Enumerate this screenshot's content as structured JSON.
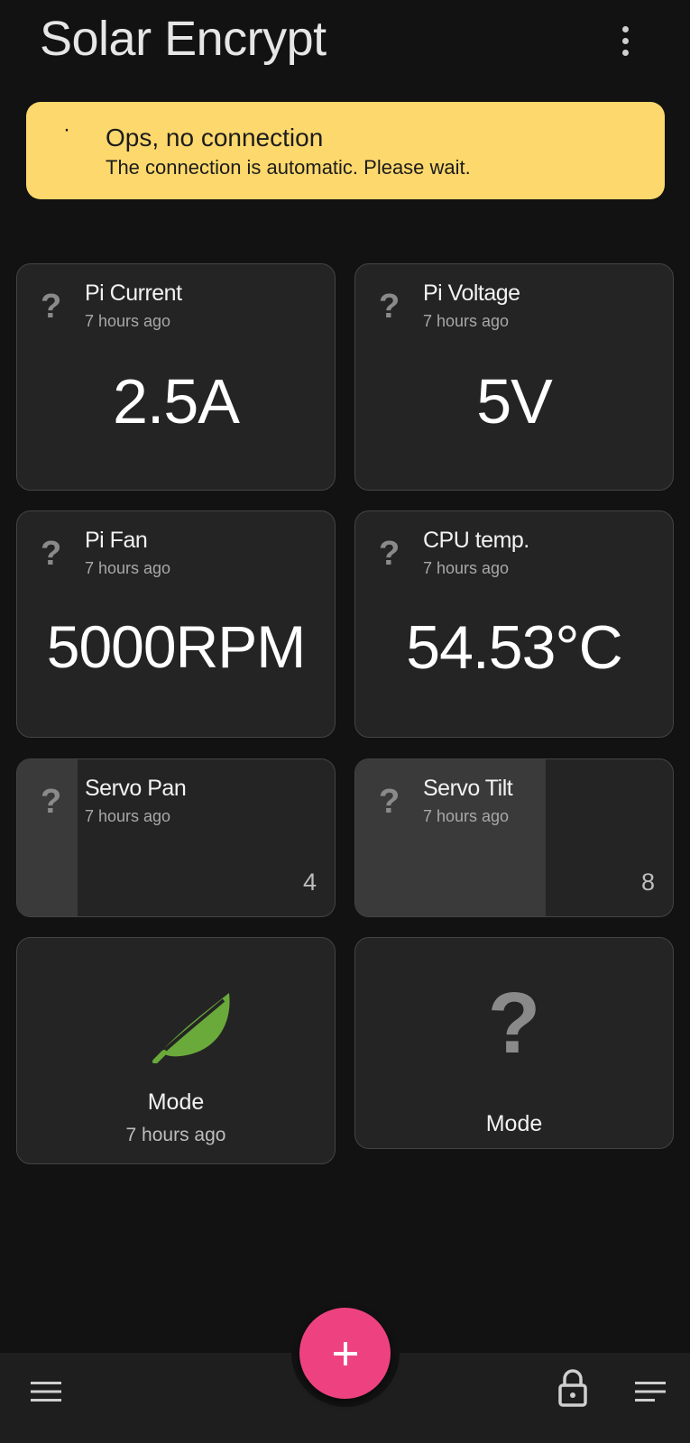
{
  "app": {
    "title": "Solar Encrypt"
  },
  "banner": {
    "bullet": "·",
    "title": "Ops, no connection",
    "message": "The connection is automatic. Please wait."
  },
  "cards": [
    {
      "title": "Pi Current",
      "time": "7 hours ago",
      "value": "2.5A",
      "icon": "question-icon"
    },
    {
      "title": "Pi Voltage",
      "time": "7 hours ago",
      "value": "5V",
      "icon": "question-icon"
    },
    {
      "title": "Pi Fan",
      "time": "7 hours ago",
      "value": "5000RPM",
      "icon": "question-icon"
    },
    {
      "title": "CPU temp.",
      "time": "7 hours ago",
      "value": "54.53°C",
      "icon": "question-icon"
    }
  ],
  "sliders": [
    {
      "title": "Servo Pan",
      "time": "7 hours ago",
      "value": "4",
      "fill_fraction": 0.19,
      "icon": "question-icon"
    },
    {
      "title": "Servo Tilt",
      "time": "7 hours ago",
      "value": "8",
      "fill_fraction": 0.6,
      "icon": "question-icon"
    }
  ],
  "modes": [
    {
      "label": "Mode",
      "time": "7 hours ago",
      "icon": "leaf-icon",
      "icon_color": "#6aaa3a"
    },
    {
      "label": "Mode",
      "icon": "question-icon"
    }
  ],
  "fab": {
    "icon": "plus-icon",
    "color": "#ee4280"
  },
  "bottom_nav": {
    "left_icon": "hamburger-menu-icon",
    "lock_icon": "lock-icon",
    "right_icon": "sort-lines-icon"
  },
  "colors": {
    "background": "#121212",
    "card": "#242424",
    "banner": "#fdd86c"
  },
  "q_mark": "?"
}
